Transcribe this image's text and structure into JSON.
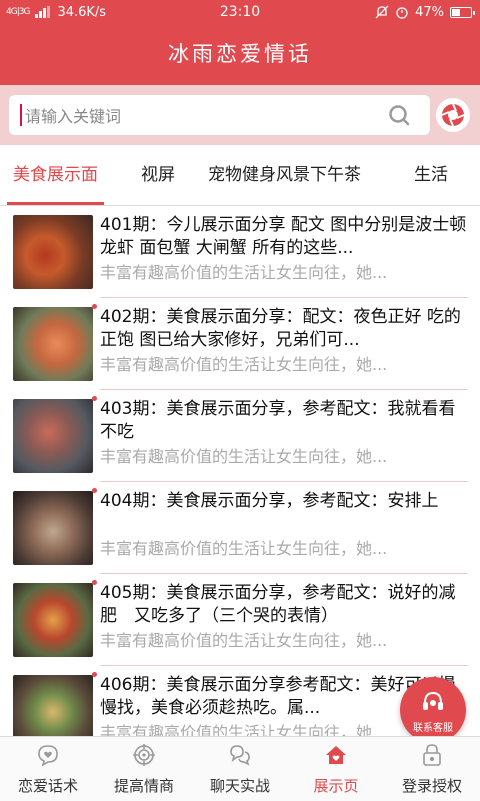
{
  "status_bar": {
    "signal_label": "4G|3G",
    "net_speed": "34.6K/s",
    "time": "23:10",
    "battery_percent": "47%",
    "battery_level": 0.47
  },
  "header": {
    "title": "冰雨恋爱情话"
  },
  "search": {
    "placeholder": "请输入关键词",
    "value": ""
  },
  "tabs": [
    {
      "label": "美食展示面",
      "active": true
    },
    {
      "label": "视屏",
      "active": false
    },
    {
      "label": "宠物健身风景下午茶",
      "active": false
    },
    {
      "label": "生活",
      "active": false
    }
  ],
  "items": [
    {
      "title": "401期：今儿展示面分享 配文  图中分别是波士顿龙虾 面包蟹 大闸蟹 所有的这些...",
      "subtitle": "丰富有趣高价值的生活让女生向往，她..."
    },
    {
      "title": "402期：美食展示面分享：配文：夜色正好 吃的正饱 图已给大家修好，兄弟们可...",
      "subtitle": "丰富有趣高价值的生活让女生向往，她..."
    },
    {
      "title": "403期：美食展示面分享，参考配文：我就看看 不吃",
      "subtitle": "丰富有趣高价值的生活让女生向往，她..."
    },
    {
      "title": "404期：美食展示面分享，参考配文：安排上",
      "subtitle": "丰富有趣高价值的生活让女生向往，她..."
    },
    {
      "title": "405期：美食展示面分享，参考配文：说好的减肥　又吃多了（三个哭的表情）",
      "subtitle": "丰富有趣高价值的生活让女生向往，她..."
    },
    {
      "title": "406期：美食展示面分享参考配文：美好可以慢慢找，美食必须趁热吃。属...",
      "subtitle": "丰富有趣高价值的生活让女生向往，她..."
    }
  ],
  "fab": {
    "label": "联系客服"
  },
  "bottom_nav": [
    {
      "label": "恋爱话术",
      "icon": "heart-chat-icon",
      "active": false
    },
    {
      "label": "提高情商",
      "icon": "target-icon",
      "active": false
    },
    {
      "label": "聊天实战",
      "icon": "chat-bubbles-icon",
      "active": false
    },
    {
      "label": "展示页",
      "icon": "home-icon",
      "active": true
    },
    {
      "label": "登录授权",
      "icon": "lock-icon",
      "active": false
    }
  ],
  "colors": {
    "brand_red": "#e04a4f",
    "search_bg": "#f2d0d1"
  }
}
